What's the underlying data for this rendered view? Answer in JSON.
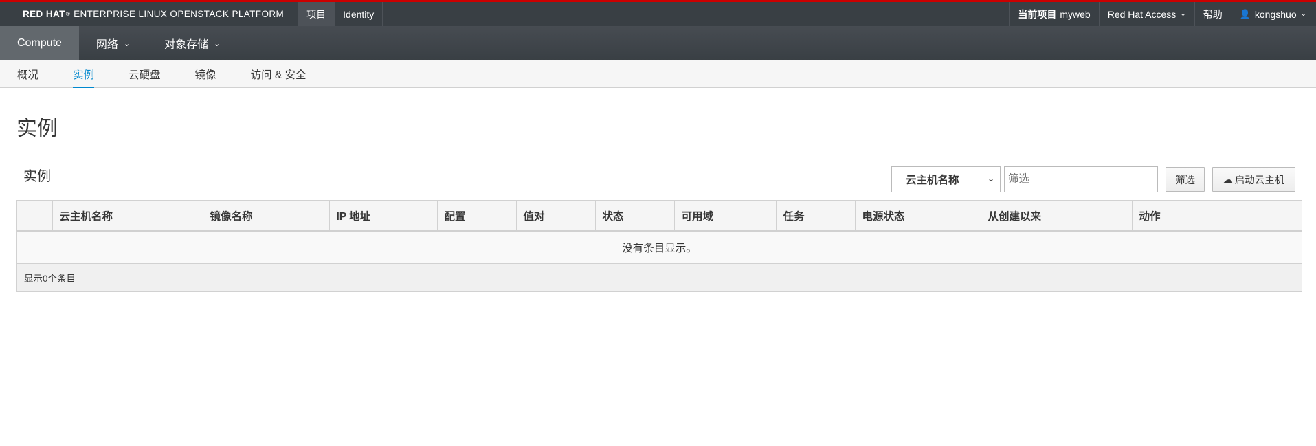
{
  "brand": {
    "bold": "RED HAT",
    "reg": "®",
    "rest": "ENTERPRISE LINUX OPENSTACK PLATFORM"
  },
  "top_tabs": [
    {
      "label": "项目",
      "active": true
    },
    {
      "label": "Identity",
      "active": false
    }
  ],
  "top_right": {
    "project_prefix": "当前项目",
    "project_name": "myweb",
    "access_label": "Red Hat Access",
    "help_label": "帮助",
    "user_label": "kongshuo"
  },
  "main_nav": [
    {
      "label": "Compute",
      "active": true
    },
    {
      "label": "网络",
      "dropdown": true
    },
    {
      "label": "对象存储",
      "dropdown": true
    }
  ],
  "sub_nav": [
    {
      "label": "概况"
    },
    {
      "label": "实例",
      "active": true
    },
    {
      "label": "云硬盘"
    },
    {
      "label": "镜像"
    },
    {
      "label": "访问 & 安全"
    }
  ],
  "page": {
    "title": "实例",
    "section_title": "实例"
  },
  "filter": {
    "select_value": "云主机名称",
    "placeholder": "筛选",
    "filter_button": "筛选",
    "launch_button": "启动云主机"
  },
  "table": {
    "columns": [
      "",
      "云主机名称",
      "镜像名称",
      "IP 地址",
      "配置",
      "值对",
      "状态",
      "可用域",
      "任务",
      "电源状态",
      "从创建以来",
      "动作"
    ],
    "empty_message": "没有条目显示。",
    "footer": "显示0个条目"
  },
  "colors": {
    "accent_red": "#cc0000",
    "link_blue": "#0088ce",
    "topbar": "#393f44"
  }
}
